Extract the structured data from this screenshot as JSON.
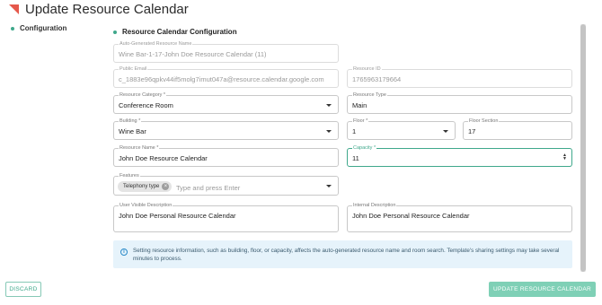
{
  "header": {
    "title": "Update Resource Calendar"
  },
  "sidebar": {
    "items": [
      {
        "label": "Configuration"
      }
    ]
  },
  "section": {
    "title": "Resource Calendar Configuration"
  },
  "fields": {
    "auto_name": {
      "label": "Auto-Generated Resource Name",
      "value": "Wine Bar-1-17-John Doe Resource Calendar (11)"
    },
    "public_email": {
      "label": "Public Email",
      "value": "c_1883e96qpkv44if5molg7imut047a@resource.calendar.google.com"
    },
    "resource_id": {
      "label": "Resource ID",
      "value": "1765963179664"
    },
    "resource_category": {
      "label": "Resource Category",
      "required": "*",
      "value": "Conference Room"
    },
    "resource_type": {
      "label": "Resource Type",
      "value": "Main"
    },
    "building": {
      "label": "Building",
      "required": "*",
      "value": "Wine Bar"
    },
    "floor": {
      "label": "Floor",
      "required": "*",
      "value": "1"
    },
    "floor_section": {
      "label": "Floor Section",
      "value": "17"
    },
    "resource_name": {
      "label": "Resource Name",
      "required": "*",
      "value": "John Doe Resource Calendar"
    },
    "capacity": {
      "label": "Capacity",
      "required": "*",
      "value": "11"
    },
    "features": {
      "label": "Features",
      "chip": "Telephony type",
      "placeholder": "Type and press Enter"
    },
    "user_visible_description": {
      "label": "User Visible Description",
      "value": "John Doe Personal Resource Calendar"
    },
    "internal_description": {
      "label": "Internal Description",
      "value": "John Doe Personal Resource Calendar"
    }
  },
  "info": {
    "text": "Setting resource information, such as building, floor, or capacity, affects the auto-generated resource name and room search. Template's sharing settings may take several minutes to process."
  },
  "buttons": {
    "discard": "DISCARD",
    "update": "UPDATE RESOURCE CALENDAR"
  },
  "colors": {
    "accent": "#3fa88b",
    "brand_flag": "#e5584b",
    "info_bg": "#e6f3fb",
    "primary_button": "#7fd0b6"
  },
  "icons": {
    "flag": "red-triangle-icon",
    "info": "info-icon",
    "chip_remove": "close-circle-icon",
    "dropdown": "caret-down-icon"
  }
}
